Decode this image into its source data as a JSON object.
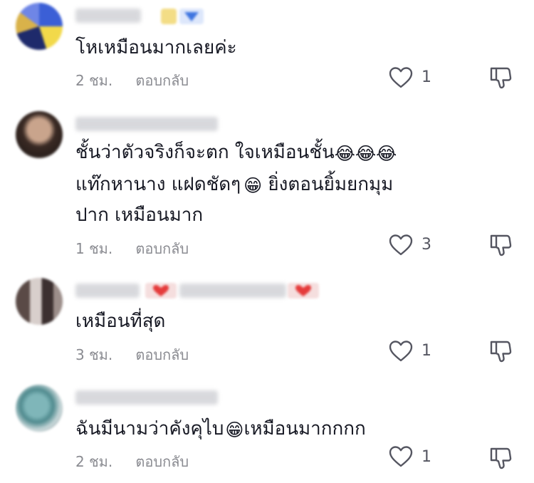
{
  "comments": [
    {
      "text": "โหเหมือนมากเลยค่ะ",
      "time": "2 ชม.",
      "reply_label": "ตอบกลับ",
      "likes": "1"
    },
    {
      "text_line1": "ชั้นว่าตัวจริงก็จะตก ใจเหมือนชั้น",
      "text_line1_emoji": "😂😂😂",
      "text_line2_a": "แท๊กหานาง แฝดชัดๆ",
      "text_line2_emoji": "😁",
      "text_line2_b": " ยิ่งตอนยิ้มยกมุม",
      "text_line3": "ปาก เหมือนมาก",
      "time": "1 ชม.",
      "reply_label": "ตอบกลับ",
      "likes": "3"
    },
    {
      "text": "เหมือนที่สุด",
      "time": "3 ชม.",
      "reply_label": "ตอบกลับ",
      "likes": "1"
    },
    {
      "text_a": "ฉันมีนามว่าคังคุไบ",
      "text_emoji": "😁",
      "text_b": "เหมือนมากกกก",
      "time": "2 ชม.",
      "reply_label": "ตอบกลับ",
      "likes": "1"
    }
  ],
  "icons": {
    "like": "heart-outline-icon",
    "dislike": "thumbs-down-outline-icon"
  },
  "colors": {
    "text": "#161823",
    "meta": "#8a8b91",
    "icon": "#555661"
  }
}
